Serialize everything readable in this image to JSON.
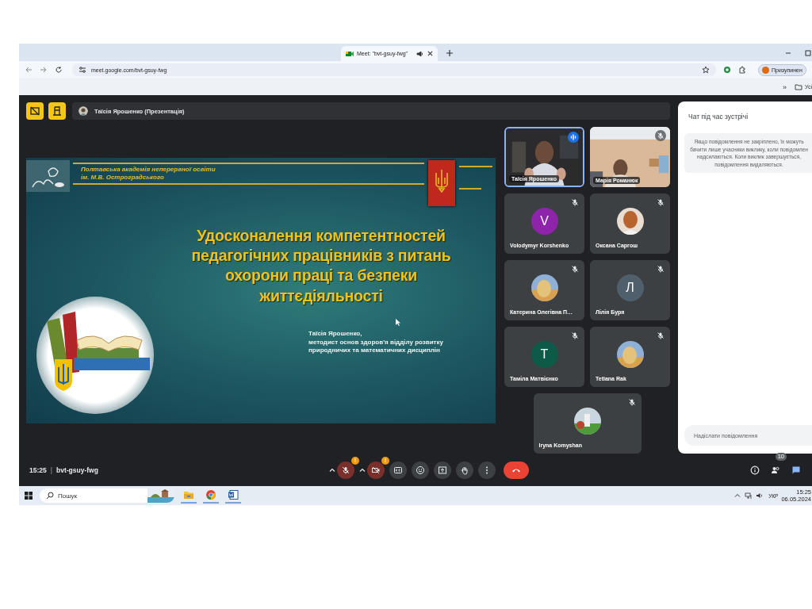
{
  "browser": {
    "tab": {
      "title": "Meet: \"bvt-gsuy-fwg\"",
      "audio": true
    },
    "url": "meet.google.com/bvt-gsuy-fwg",
    "profile": "Призупинен",
    "bookmarks_more": "»",
    "bookmarks_folder": "Усі"
  },
  "presenter_bar": {
    "label": "Таїсія Ярошенко (Презентація)"
  },
  "slide": {
    "org": "Полтавська академія неперервної освіти\nім. М.В. Остроградського",
    "title": "Удосконалення компетентностей\nпедагогічних працівників з питань\nохорони праці та безпеки\nжиттєдіяльності",
    "author": "Таїсія Ярошенко,\nметодист основ здоров'я відділу розвитку\nприродничих та математичних дисциплін"
  },
  "tiles": [
    {
      "name": "Таїсія Ярошенко",
      "kind": "video",
      "muted": false,
      "speaking": true
    },
    {
      "name": "Марія Романюк",
      "kind": "video",
      "muted": true,
      "speaking": false
    },
    {
      "name": "Volodymyr Korshenko",
      "kind": "letter",
      "letter": "V",
      "color": "#8e24aa",
      "muted": true,
      "speaking": false
    },
    {
      "name": "Оксана Саргош",
      "muted": true,
      "speaking": false
    },
    {
      "name": "Катерина Олегівна П…",
      "muted": true,
      "speaking": false
    },
    {
      "name": "Лілія Буря",
      "kind": "letter",
      "letter": "Л",
      "color": "#4f5f6b",
      "muted": true,
      "speaking": false
    },
    {
      "name": "Таміла Матвієнко",
      "kind": "letter",
      "letter": "T",
      "color": "#0d5a48",
      "muted": true,
      "speaking": false
    },
    {
      "name": "Tetiana Rak",
      "muted": true,
      "speaking": false
    },
    {
      "name": "Iryna Komyshan",
      "muted": true,
      "speaking": false
    }
  ],
  "chat": {
    "title": "Чат під час зустрічі",
    "notice": "Якщо повідомлення не закріплено, їх можуть\nбачити лише учасники виклику, коли повідомлен\nнадсилаються. Коли виклик завершується,\nповідомлення видаляються.",
    "placeholder": "Надіслати повідомлення"
  },
  "bottom_bar": {
    "time": "15:25",
    "separator": "|",
    "code": "bvt-gsuy-fwg",
    "controls": [
      {
        "kind": "mic",
        "on": false,
        "alert": "!"
      },
      {
        "kind": "camera",
        "on": false,
        "alert": "!"
      },
      {
        "kind": "captions"
      },
      {
        "kind": "emoji"
      },
      {
        "kind": "present"
      },
      {
        "kind": "hand"
      },
      {
        "kind": "more"
      },
      {
        "kind": "leave"
      }
    ],
    "side": [
      {
        "kind": "info",
        "selected": false
      },
      {
        "kind": "people",
        "count": "10",
        "selected": false
      },
      {
        "kind": "chat",
        "selected": true
      }
    ]
  },
  "taskbar": {
    "search_placeholder": "Пошук",
    "apps": [
      {
        "kind": "explorer"
      },
      {
        "kind": "chrome"
      },
      {
        "kind": "word"
      }
    ],
    "language": "УКР",
    "time": "15:25",
    "date": "06.05.2024"
  }
}
